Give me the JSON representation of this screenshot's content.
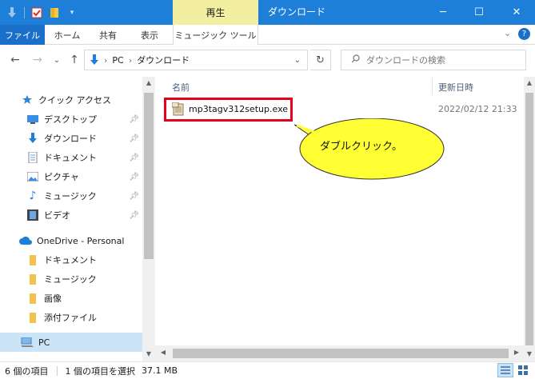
{
  "titlebar": {
    "context_tab": "再生",
    "title": "ダウンロード",
    "minimize": "─",
    "maximize": "☐",
    "close": "✕"
  },
  "ribbon": {
    "tabs": [
      "ファイル",
      "ホーム",
      "共有",
      "表示"
    ],
    "context_tab": "ミュージック ツール"
  },
  "address": {
    "path": [
      "PC",
      "ダウンロード"
    ],
    "separator": "›",
    "search_placeholder": "ダウンロードの検索"
  },
  "nav": {
    "quick_access": "クイック アクセス",
    "quick_items": [
      {
        "label": "デスクトップ",
        "icon": "desktop-icon"
      },
      {
        "label": "ダウンロード",
        "icon": "download-icon"
      },
      {
        "label": "ドキュメント",
        "icon": "document-icon"
      },
      {
        "label": "ピクチャ",
        "icon": "picture-icon"
      },
      {
        "label": "ミュージック",
        "icon": "music-icon"
      },
      {
        "label": "ビデオ",
        "icon": "video-icon"
      }
    ],
    "onedrive": "OneDrive - Personal",
    "onedrive_items": [
      "ドキュメント",
      "ミュージック",
      "画像",
      "添付ファイル"
    ],
    "pc": "PC"
  },
  "content": {
    "col_name": "名前",
    "col_date": "更新日時",
    "files": [
      {
        "name": "mp3tagv312setup.exe",
        "date": "2022/02/12 21:33"
      }
    ],
    "callout": "ダブルクリック。"
  },
  "status": {
    "count": "6 個の項目",
    "selected": "1 個の項目を選択",
    "size": "37.1 MB"
  },
  "colors": {
    "titlebar": "#1e7fd8",
    "context_tab": "#f3efa1",
    "highlight": "#e2001a",
    "callout": "#ffff33"
  }
}
